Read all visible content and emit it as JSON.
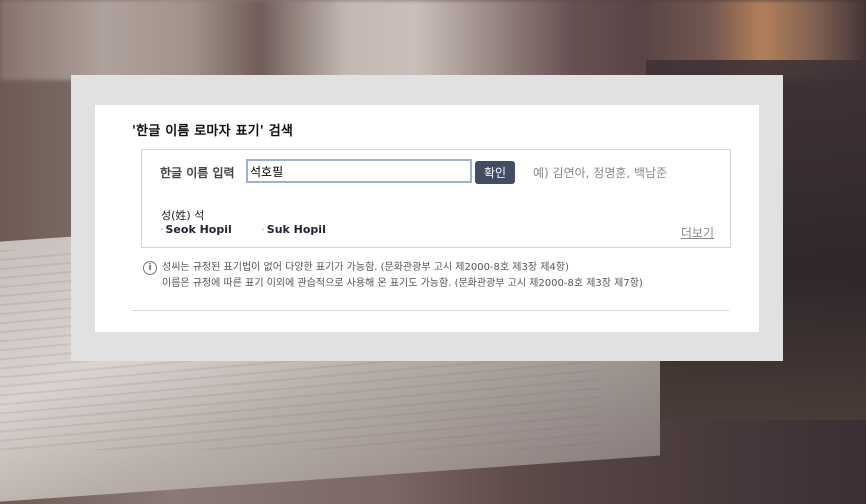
{
  "title": "'한글 이름 로마자 표기' 검색",
  "search": {
    "label": "한글 이름 입력",
    "value": "석호필",
    "button": "확인",
    "example": "예) 김연아, 정명훈, 백남준"
  },
  "result": {
    "surname_label": "성(姓) 석",
    "romanizations": [
      "Seok Hopil",
      "Suk Hopil"
    ],
    "more": "더보기"
  },
  "notes": {
    "icon": "info-icon",
    "line1": "성씨는 규정된 표기법이 없어 다양한 표기가 가능함. (문화관광부 고시 제2000-8호 제3장 제4항)",
    "line2": "이름은 규정에 따른 표기 이외에 관습적으로 사용해 온 표기도 가능함. (문화관광부 고시 제2000-8호 제3장 제7항)"
  }
}
